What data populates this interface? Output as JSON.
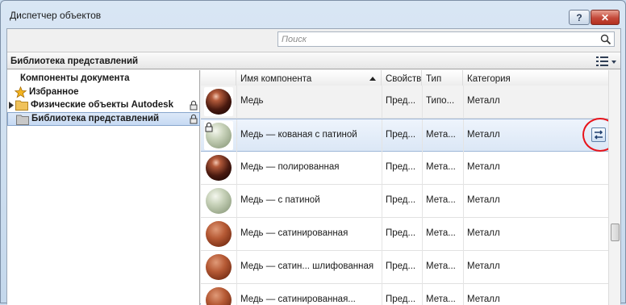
{
  "window": {
    "title": "Диспетчер объектов",
    "help_label": "?",
    "close_label": "✕"
  },
  "search": {
    "placeholder": "Поиск"
  },
  "library": {
    "title": "Библиотека представлений"
  },
  "tree": {
    "items": [
      {
        "label": "Компоненты документа",
        "icon": "none"
      },
      {
        "label": "Избранное",
        "icon": "star-icon"
      },
      {
        "label": "Физические объекты Autodesk",
        "icon": "folder-icon",
        "locked": true
      },
      {
        "label": "Библиотека представлений",
        "icon": "gray-folder-icon",
        "locked": true,
        "selected": true
      }
    ]
  },
  "table": {
    "columns": [
      "Имя компонента",
      "Свойства",
      "Тип",
      "Категория"
    ],
    "rows": [
      {
        "name": "Медь",
        "props": "Пред...",
        "type": "Типо...",
        "category": "Металл",
        "swatch": "polished"
      },
      {
        "name": "Медь — кованая с патиной",
        "props": "Пред...",
        "type": "Мета...",
        "category": "Металл",
        "swatch": "patina"
      },
      {
        "name": "Медь — полированная",
        "props": "Пред...",
        "type": "Мета...",
        "category": "Металл",
        "swatch": "polished"
      },
      {
        "name": "Медь — с патиной",
        "props": "Пред...",
        "type": "Мета...",
        "category": "Металл",
        "swatch": "patina"
      },
      {
        "name": "Медь — сатинированная",
        "props": "Пред...",
        "type": "Мета...",
        "category": "Металл",
        "swatch": "satin"
      },
      {
        "name": "Медь — сатин... шлифованная",
        "props": "Пред...",
        "type": "Мета...",
        "category": "Металл",
        "swatch": "satin"
      },
      {
        "name": "Медь — сатинированная...",
        "props": "Пред...",
        "type": "Мета...",
        "category": "Металл",
        "swatch": "satin"
      }
    ]
  },
  "colors": {
    "accent": "#e8141b",
    "selection": "#c6daf3"
  }
}
